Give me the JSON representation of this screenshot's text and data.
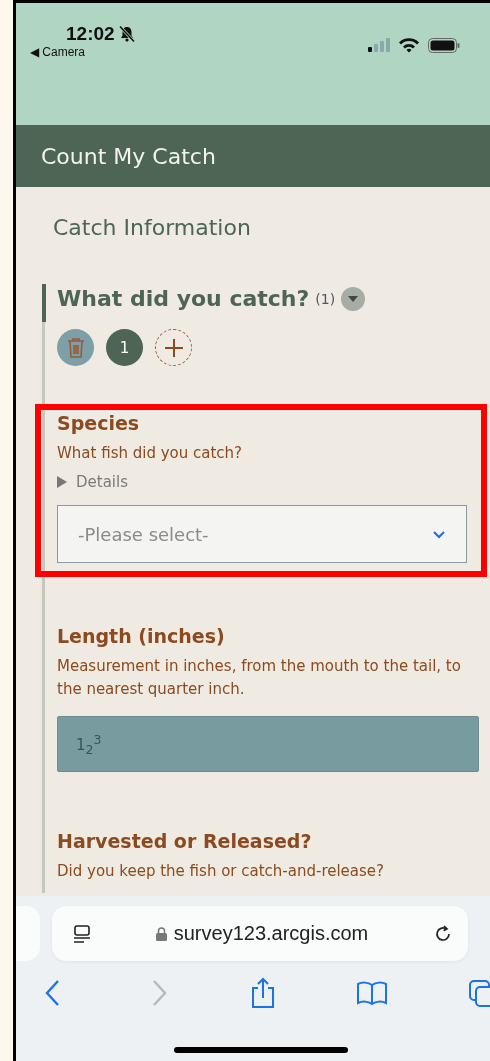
{
  "status_bar": {
    "time": "12:02",
    "silent": true,
    "back_app": "◀ Camera"
  },
  "app_header": {
    "title": "Count My Catch"
  },
  "form": {
    "section_title": "Catch Information",
    "repeat": {
      "title": "What did you catch?",
      "count": "(1)",
      "expanded": true,
      "pages": [
        {
          "label": "1",
          "selected": true
        }
      ]
    },
    "questions": [
      {
        "kind": "select",
        "label": "Species",
        "hint": "What fish did you catch?",
        "details": "Details",
        "placeholder": "-Please select-",
        "highlighted": true
      },
      {
        "kind": "number",
        "label": "Length (inches)",
        "hint": "Measurement in inches, from the mouth to the tail, to the nearest quarter inch.",
        "placeholder": "1$_{2}$$^{3}$",
        "highlighted": false
      },
      {
        "kind": "choice",
        "label": "Harvested or Released?",
        "hint": "Did you keep the fish or catch-and-release?",
        "highlighted": false
      }
    ]
  },
  "browser": {
    "url": "survey123.arcgis.com",
    "toolbar": [
      {
        "kind": "back",
        "disabled": false
      },
      {
        "kind": "forward",
        "disabled": true
      },
      {
        "kind": "share",
        "disabled": false
      },
      {
        "kind": "bookmarks",
        "disabled": false
      },
      {
        "kind": "tabs",
        "disabled": false
      }
    ]
  }
}
